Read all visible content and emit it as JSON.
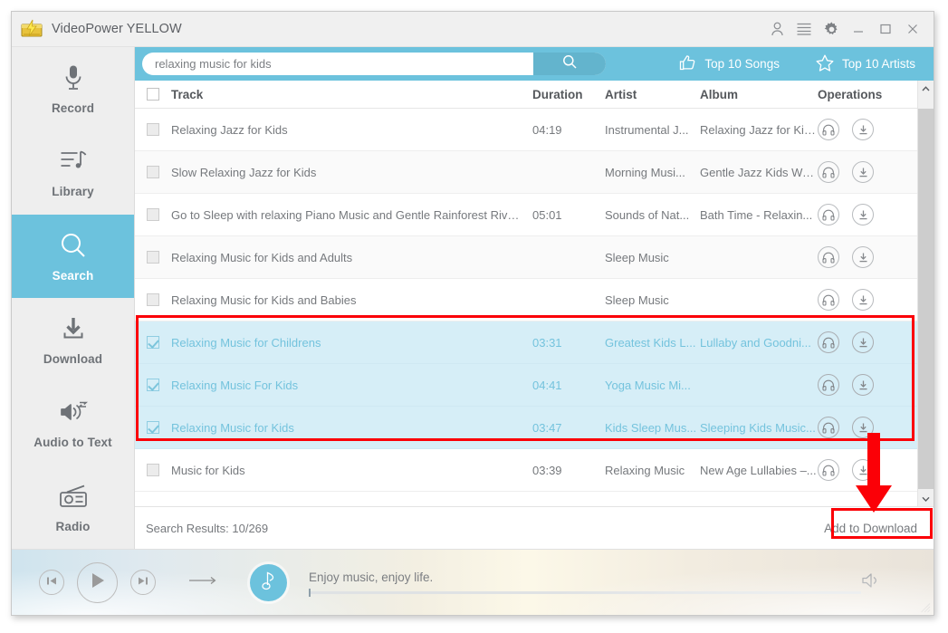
{
  "window": {
    "title": "VideoPower YELLOW",
    "logo_icon": "videopower-logo-icon",
    "controls": {
      "account_icon": "account-icon",
      "list_icon": "list-icon",
      "settings_icon": "gear-icon",
      "minimize_icon": "minimize-icon",
      "maximize_icon": "maximize-icon",
      "close_icon": "close-icon"
    }
  },
  "sidebar": {
    "items": [
      {
        "label": "Record",
        "icon": "microphone-icon",
        "active": false
      },
      {
        "label": "Library",
        "icon": "music-list-icon",
        "active": false
      },
      {
        "label": "Search",
        "icon": "search-icon",
        "active": true
      },
      {
        "label": "Download",
        "icon": "download-icon",
        "active": false
      },
      {
        "label": "Audio to Text",
        "icon": "speaker-text-icon",
        "active": false
      },
      {
        "label": "Radio",
        "icon": "radio-icon",
        "active": false
      }
    ]
  },
  "search": {
    "value": "relaxing music for kids",
    "placeholder": "Search",
    "go_icon": "search-icon",
    "top_songs_label": "Top 10 Songs",
    "top_songs_icon": "thumbs-up-icon",
    "top_artists_label": "Top 10 Artists",
    "top_artists_icon": "star-icon"
  },
  "table": {
    "columns": {
      "track": "Track",
      "duration": "Duration",
      "artist": "Artist",
      "album": "Album",
      "operations": "Operations"
    },
    "header_checked": false,
    "operation_icons": {
      "play": "headphones-icon",
      "download": "download-circle-icon"
    },
    "rows": [
      {
        "checked": false,
        "selected": false,
        "track": "Relaxing Jazz for Kids",
        "duration": "04:19",
        "artist": "Instrumental J...",
        "album": "Relaxing Jazz for Kid..."
      },
      {
        "checked": false,
        "selected": false,
        "track": "Slow Relaxing Jazz for Kids",
        "duration": "",
        "artist": "Morning Musi...",
        "album": "Gentle Jazz Kids Wa..."
      },
      {
        "checked": false,
        "selected": false,
        "track": "Go to Sleep with relaxing Piano Music and Gentle Rainforest Rive...",
        "duration": "05:01",
        "artist": "Sounds of Nat...",
        "album": "Bath Time - Relaxin..."
      },
      {
        "checked": false,
        "selected": false,
        "track": "Relaxing Music for Kids and Adults",
        "duration": "",
        "artist": "Sleep Music",
        "album": ""
      },
      {
        "checked": false,
        "selected": false,
        "track": "Relaxing Music for Kids and Babies",
        "duration": "",
        "artist": "Sleep Music",
        "album": ""
      },
      {
        "checked": true,
        "selected": true,
        "track": "Relaxing Music for Childrens",
        "duration": "03:31",
        "artist": "Greatest Kids L...",
        "album": "Lullaby and Goodni..."
      },
      {
        "checked": true,
        "selected": true,
        "track": "Relaxing Music For Kids",
        "duration": "04:41",
        "artist": "Yoga Music Mi...",
        "album": ""
      },
      {
        "checked": true,
        "selected": true,
        "track": "Relaxing Music for Kids",
        "duration": "03:47",
        "artist": "Kids Sleep Mus...",
        "album": "Sleeping Kids Music..."
      },
      {
        "checked": false,
        "selected": false,
        "track": "Music for Kids",
        "duration": "03:39",
        "artist": "Relaxing Music",
        "album": "New Age Lullabies –..."
      }
    ]
  },
  "footer": {
    "results_text": "Search Results: 10/269",
    "add_to_download_label": "Add to Download"
  },
  "player": {
    "prev_icon": "previous-track-icon",
    "play_icon": "play-icon",
    "next_icon": "next-track-icon",
    "repeat_icon": "repeat-arrow-icon",
    "note_icon": "music-note-icon",
    "message": "Enjoy music, enjoy life.",
    "volume_icon": "volume-icon"
  },
  "annotations": {
    "selection_box_color": "#fb0007",
    "button_box_color": "#fb0007",
    "arrow_color": "#fb0007"
  }
}
